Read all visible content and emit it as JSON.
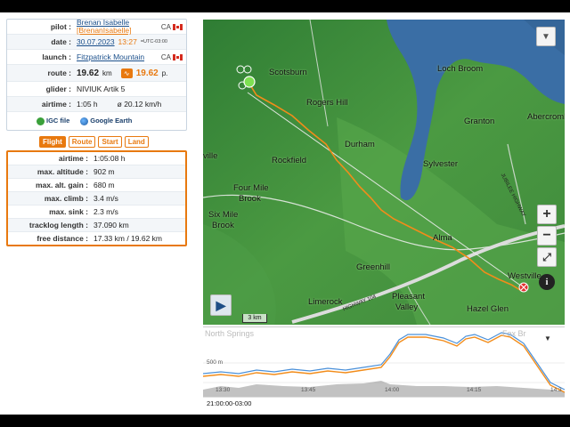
{
  "flight": {
    "pilot_label": "pilot :",
    "pilot_name": "Brenan Isabelle",
    "pilot_handle": "[BrenanIsabelle]",
    "country": "CA",
    "date_label": "date :",
    "date": "30.07.2023",
    "time": "13:27",
    "utc": "=UTC-03:00",
    "launch_label": "launch :",
    "launch": "Fitzpatrick Mountain",
    "launch_country": "CA",
    "route_label": "route :",
    "route_km": "19.62",
    "route_unit": "km",
    "route_points": "19.62",
    "route_points_unit": "p.",
    "glider_label": "glider :",
    "glider": "NIVIUK Artik 5",
    "airtime_label": "airtime :",
    "airtime": "1:05 h",
    "avg_speed": "ø 20.12 km/h",
    "igc_link": "IGC file",
    "ge_link": "Google Earth"
  },
  "tabs": [
    {
      "label": "Flight"
    },
    {
      "label": "Route"
    },
    {
      "label": "Start"
    },
    {
      "label": "Land"
    }
  ],
  "stats": [
    {
      "label": "airtime :",
      "value": "1:05:08 h"
    },
    {
      "label": "max. altitude :",
      "value": "902 m"
    },
    {
      "label": "max. alt. gain :",
      "value": "680 m"
    },
    {
      "label": "max. climb :",
      "value": "3.4 m/s"
    },
    {
      "label": "max. sink :",
      "value": "2.3 m/s"
    },
    {
      "label": "tracklog length :",
      "value": "37.090 km"
    },
    {
      "label": "free distance :",
      "value": "17.33 km / 19.62 km"
    }
  ],
  "map": {
    "labels": [
      "Scotsburn",
      "Loch Broom",
      "Rogers Hill",
      "Granton",
      "Abercrombie",
      "ville",
      "Durham",
      "Rockfield",
      "Sylvester",
      "Four Mile",
      "Brook",
      "Six Mile",
      "Brook",
      "Alma",
      "Greenhill",
      "Westville",
      "Limerock",
      "Pleasant",
      "Valley",
      "Hazel Glen"
    ],
    "highway_labels": [
      "JUBILEE HIGHWAY",
      "HIGHWAY 104"
    ],
    "scale": "3 km",
    "zoom_in": "+",
    "zoom_out": "−",
    "fullscreen": "⤢",
    "play": "▶",
    "info": "i",
    "dropdown": "▼",
    "colors": {
      "track": "#f28c1a",
      "forest": "#3d8c3b",
      "water": "#3a6ea5"
    }
  },
  "profile": {
    "alt_tick": "500 m",
    "time_ticks": [
      "13:30",
      "13:45",
      "14:00",
      "14:15",
      "14:3"
    ],
    "faded_left": "North Springs",
    "faded_right": "Fox Br",
    "colors": {
      "altitude": "#f28c1a",
      "baro": "#4a90d9",
      "ground": "#9a9a9a"
    }
  },
  "timebar": "21:00:00-03:00"
}
